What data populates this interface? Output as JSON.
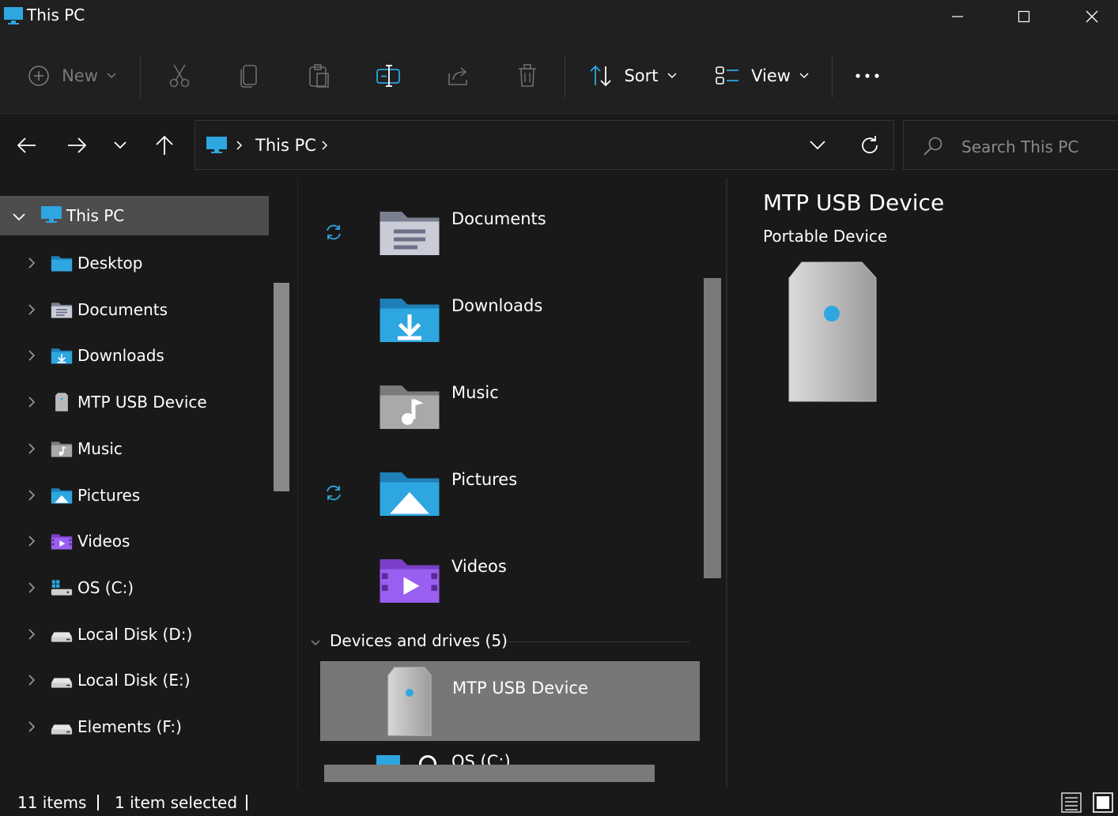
{
  "window": {
    "title": "This PC"
  },
  "toolbar": {
    "new_label": "New",
    "sort_label": "Sort",
    "view_label": "View"
  },
  "address": {
    "crumb": "This PC",
    "search_placeholder": "Search This PC"
  },
  "nav": {
    "root": "This PC",
    "items": [
      {
        "label": "Desktop",
        "icon": "desktop-folder-icon"
      },
      {
        "label": "Documents",
        "icon": "documents-folder-icon"
      },
      {
        "label": "Downloads",
        "icon": "downloads-folder-icon"
      },
      {
        "label": "MTP USB Device",
        "icon": "usb-device-icon"
      },
      {
        "label": "Music",
        "icon": "music-folder-icon"
      },
      {
        "label": "Pictures",
        "icon": "pictures-folder-icon"
      },
      {
        "label": "Videos",
        "icon": "videos-folder-icon"
      },
      {
        "label": "OS (C:)",
        "icon": "os-drive-icon"
      },
      {
        "label": "Local Disk (D:)",
        "icon": "disk-drive-icon"
      },
      {
        "label": "Local Disk (E:)",
        "icon": "disk-drive-icon"
      },
      {
        "label": "Elements (F:)",
        "icon": "disk-drive-icon"
      }
    ]
  },
  "main": {
    "folders": [
      {
        "label": "Documents",
        "icon": "documents-folder-icon",
        "sync": true
      },
      {
        "label": "Downloads",
        "icon": "downloads-folder-icon",
        "sync": false
      },
      {
        "label": "Music",
        "icon": "music-folder-icon",
        "sync": false
      },
      {
        "label": "Pictures",
        "icon": "pictures-folder-icon",
        "sync": true
      },
      {
        "label": "Videos",
        "icon": "videos-folder-icon",
        "sync": false
      }
    ],
    "group_header": "Devices and drives (5)",
    "selected_device": "MTP USB Device",
    "partial_next": "OS (C:)"
  },
  "details": {
    "title": "MTP USB Device",
    "subtitle": "Portable Device"
  },
  "status": {
    "items": "11 items",
    "selected": "1 item selected"
  },
  "colors": {
    "accent": "#3aa0d8",
    "background": "#191919",
    "selected_row": "#777777"
  }
}
